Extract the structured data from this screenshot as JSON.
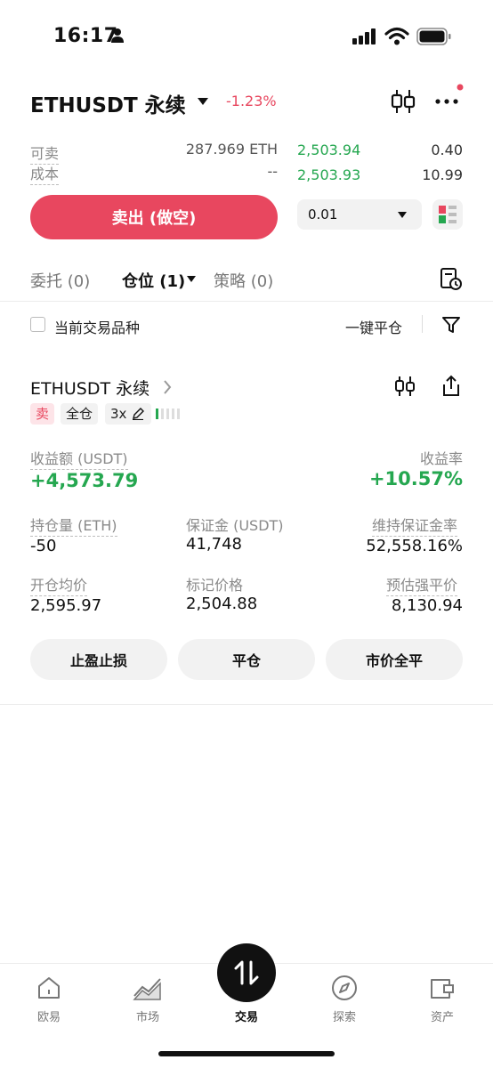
{
  "status_bar": {
    "time": "16:17"
  },
  "header": {
    "symbol": "ETHUSDT 永续",
    "change": "-1.23%"
  },
  "trade_panel": {
    "available_label": "可卖",
    "available_value": "287.969 ETH",
    "cost_label": "成本",
    "cost_value": "--",
    "sell_button": "卖出 (做空)",
    "orderbook": [
      {
        "price": "2,503.94",
        "qty": "0.40"
      },
      {
        "price": "2,503.93",
        "qty": "10.99"
      }
    ],
    "precision_value": "0.01"
  },
  "tabs": {
    "orders": "委托 (0)",
    "positions": "仓位 (1)",
    "strategies": "策略 (0)"
  },
  "filter_bar": {
    "current_symbol_label": "当前交易品种",
    "close_all": "一键平仓"
  },
  "position": {
    "symbol": "ETHUSDT 永续",
    "side": "卖",
    "margin_mode": "全仓",
    "leverage": "3x",
    "pnl_label": "收益额 (USDT)",
    "pnl_value": "+4,573.79",
    "roi_label": "收益率",
    "roi_value": "+10.57%",
    "size_label": "持仓量 (ETH)",
    "size_value": "-50",
    "margin_label": "保证金 (USDT)",
    "margin_value": "41,748",
    "maint_label": "维持保证金率",
    "maint_value": "52,558.16%",
    "entry_label": "开仓均价",
    "entry_value": "2,595.97",
    "mark_label": "标记价格",
    "mark_value": "2,504.88",
    "liq_label": "预估强平价",
    "liq_value": "8,130.94",
    "btn_tpsl": "止盈止损",
    "btn_close": "平仓",
    "btn_market_close": "市价全平"
  },
  "bottom_nav": {
    "home": "欧易",
    "market": "市场",
    "trade": "交易",
    "explore": "探索",
    "assets": "资产"
  },
  "colors": {
    "sell_red": "#e8475f",
    "buy_green": "#25a750"
  }
}
